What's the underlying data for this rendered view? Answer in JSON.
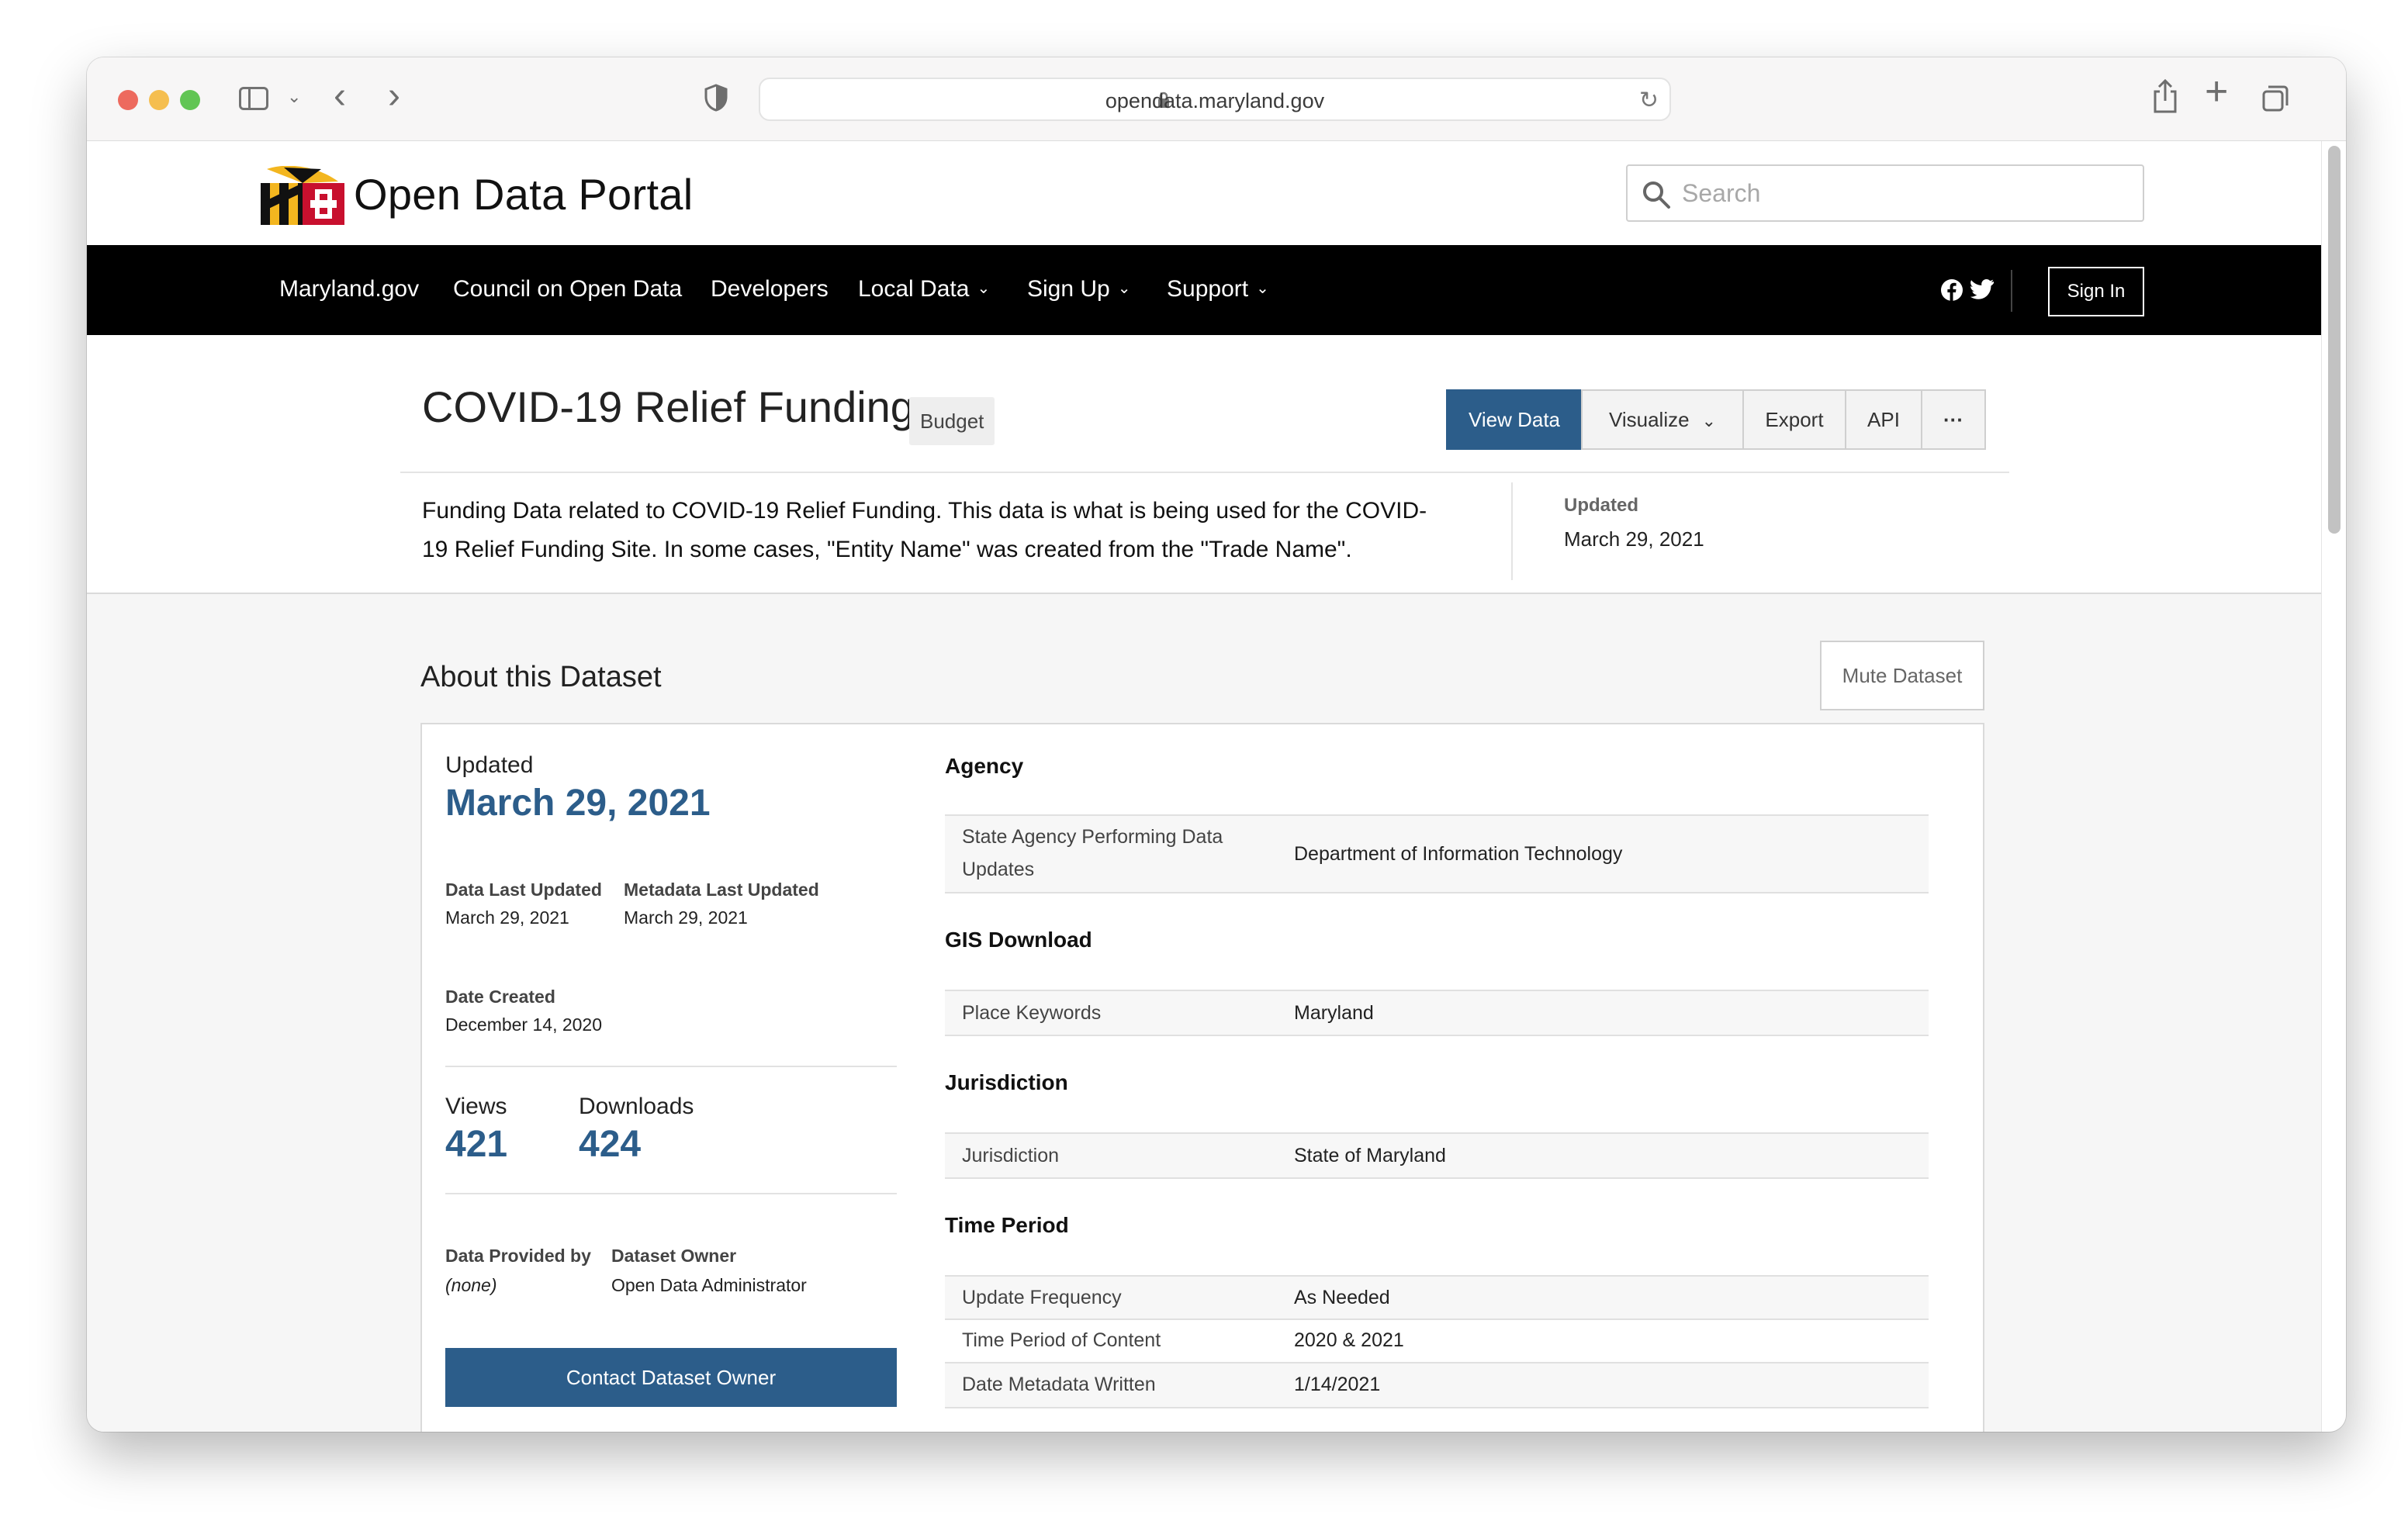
{
  "browser": {
    "url": "opendata.maryland.gov"
  },
  "site": {
    "title": "Open Data Portal",
    "search_placeholder": "Search",
    "nav": [
      {
        "label": "Maryland.gov",
        "has_menu": false
      },
      {
        "label": "Council on Open Data",
        "has_menu": false
      },
      {
        "label": "Developers",
        "has_menu": false
      },
      {
        "label": "Local Data",
        "has_menu": true
      },
      {
        "label": "Sign Up",
        "has_menu": true
      },
      {
        "label": "Support",
        "has_menu": true
      }
    ],
    "social": [
      "facebook-icon",
      "twitter-icon"
    ],
    "sign_in": "Sign In"
  },
  "dataset": {
    "title": "COVID-19 Relief Funding",
    "tag": "Budget",
    "actions": {
      "view_data": "View Data",
      "visualize": "Visualize",
      "export": "Export",
      "api": "API",
      "more": "···"
    },
    "description": "Funding Data related to COVID-19 Relief Funding. This data is what is being used for the COVID-19 Relief Funding Site. In some cases, \"Entity Name\" was created from the \"Trade Name\".",
    "updated_label": "Updated",
    "updated_value": "March 29, 2021"
  },
  "about": {
    "title": "About this Dataset",
    "mute_button": "Mute Dataset",
    "updated_label": "Updated",
    "updated_value": "March 29, 2021",
    "data_last_updated_label": "Data Last Updated",
    "data_last_updated_value": "March 29, 2021",
    "metadata_last_updated_label": "Metadata Last Updated",
    "metadata_last_updated_value": "March 29, 2021",
    "date_created_label": "Date Created",
    "date_created_value": "December 14, 2020",
    "views_label": "Views",
    "views_value": "421",
    "downloads_label": "Downloads",
    "downloads_value": "424",
    "data_provided_by_label": "Data Provided by",
    "data_provided_by_value": "(none)",
    "dataset_owner_label": "Dataset Owner",
    "dataset_owner_value": "Open Data Administrator",
    "contact_button": "Contact Dataset Owner"
  },
  "metadata": {
    "agency": {
      "title": "Agency",
      "rows": [
        {
          "key_line1": "State Agency Performing Data",
          "key_line2": "Updates",
          "value": "Department of Information Technology"
        }
      ]
    },
    "gis": {
      "title": "GIS Download",
      "rows": [
        {
          "key": "Place Keywords",
          "value": "Maryland"
        }
      ]
    },
    "jurisdiction": {
      "title": "Jurisdiction",
      "rows": [
        {
          "key": "Jurisdiction",
          "value": "State of Maryland"
        }
      ]
    },
    "time_period": {
      "title": "Time Period",
      "rows": [
        {
          "key": "Update Frequency",
          "value": "As Needed"
        },
        {
          "key": "Time Period of Content",
          "value": "2020 & 2021"
        },
        {
          "key": "Date Metadata Written",
          "value": "1/14/2021"
        }
      ]
    }
  },
  "colors": {
    "primary": "#2c5d8a",
    "navbar": "#000000",
    "md_gold": "#f3b61f",
    "md_red": "#c8102e"
  }
}
